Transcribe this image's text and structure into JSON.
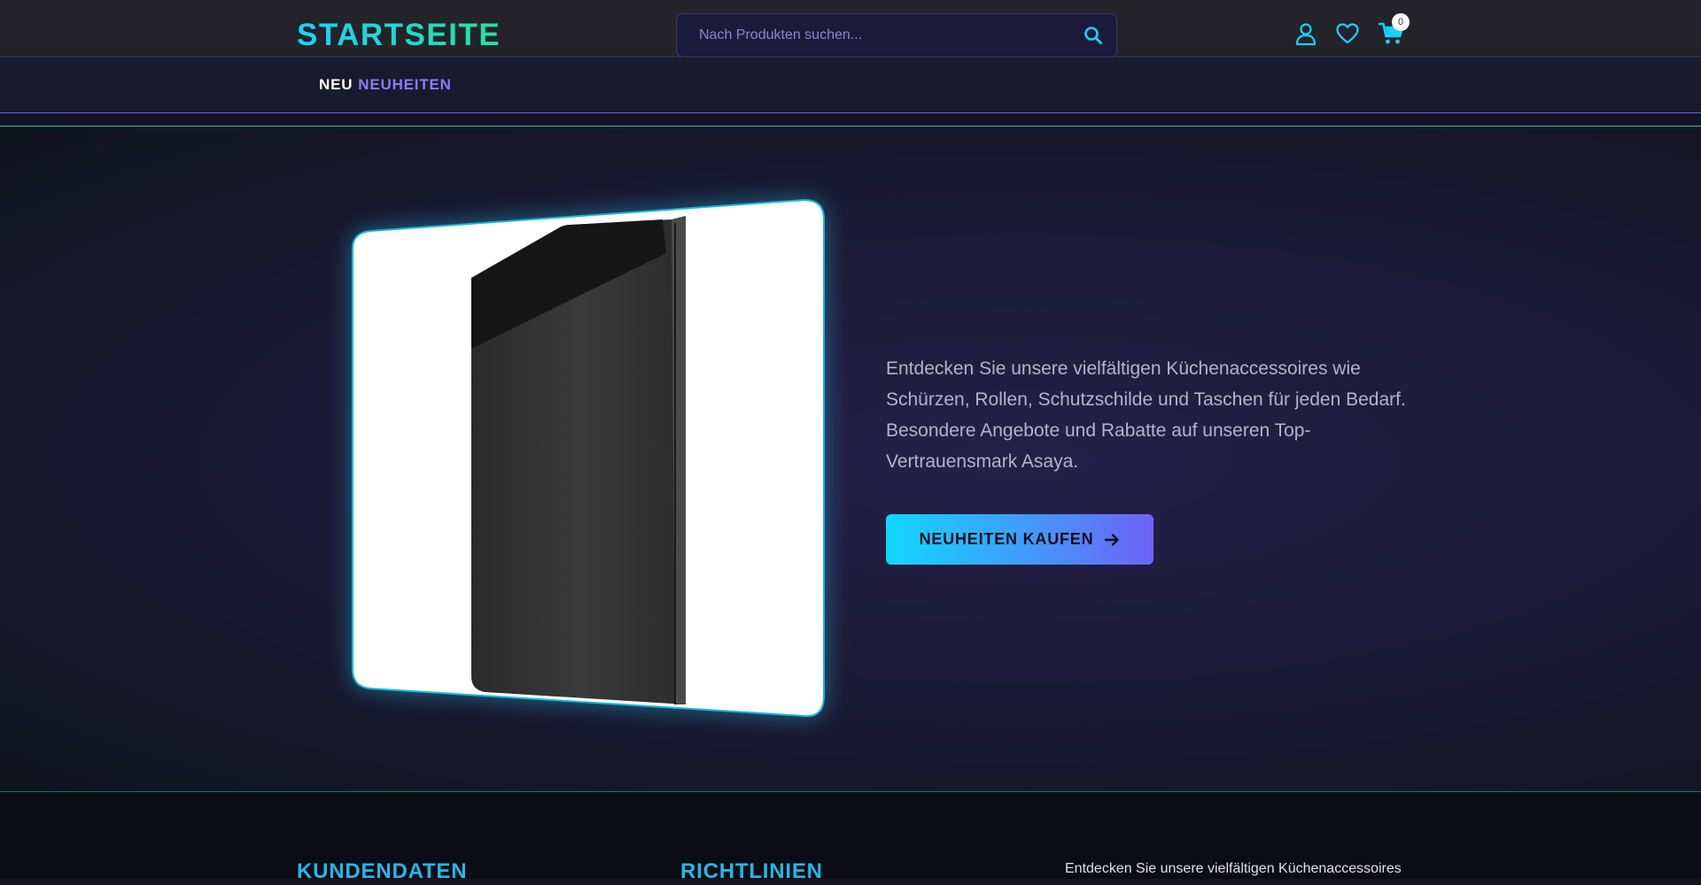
{
  "header": {
    "logo": "STARTSEITE",
    "search_placeholder": "Nach Produkten suchen...",
    "cart_count": "0"
  },
  "nav": {
    "items": [
      {
        "prefix": "NEU",
        "label": "NEUHEITEN"
      }
    ]
  },
  "hero": {
    "description": "Entdecken Sie unsere vielfältigen Küchenaccessoires wie Schürzen, Rollen, Schutzschilde und Taschen für jeden Bedarf. Besondere Angebote und Rabatte auf unseren Top-Vertrauensmark Asaya.",
    "cta_label": "NEUHEITEN KAUFEN"
  },
  "footer": {
    "col1_title": "KUNDENDATEN",
    "col2_title": "RICHTLINIEN",
    "about_text": "Entdecken Sie unsere vielfältigen Küchenaccessoires"
  },
  "colors": {
    "accent_cyan": "#1ad0ff",
    "accent_purple": "#6e63f5",
    "accent_green": "#22e3a0"
  }
}
